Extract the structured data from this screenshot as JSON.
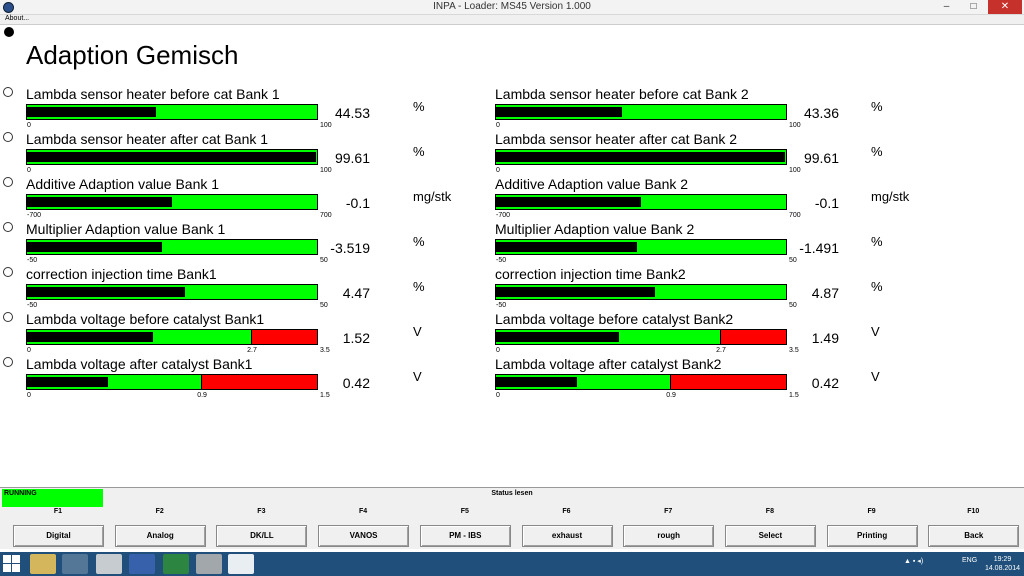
{
  "window": {
    "title": "INPA - Loader:  MS45 Version 1.000",
    "minimize": "–",
    "maximize": "□",
    "close": "✕"
  },
  "menu": {
    "about": "About..."
  },
  "page": {
    "title": "Adaption Gemisch"
  },
  "left": [
    {
      "label": "Lambda sensor heater before cat Bank 1",
      "value": "44.53",
      "unit": "%",
      "min": "0",
      "max": "100",
      "fill": 0.4453
    },
    {
      "label": "Lambda sensor heater after cat Bank 1",
      "value": "99.61",
      "unit": "%",
      "min": "0",
      "max": "100",
      "fill": 0.9961
    },
    {
      "label": "Additive Adaption value Bank 1",
      "value": "-0.1",
      "unit": "mg/stk",
      "min": "-700",
      "max": "700",
      "fill": 0.4999
    },
    {
      "label": "Multiplier Adaption value Bank 1",
      "value": "-3.519",
      "unit": "%",
      "min": "-50",
      "max": "50",
      "fill": 0.4648
    },
    {
      "label": "correction injection time Bank1",
      "value": "4.47",
      "unit": "%",
      "min": "-50",
      "max": "50",
      "fill": 0.5447
    },
    {
      "label": "Lambda voltage before catalyst Bank1",
      "value": "1.52",
      "unit": "V",
      "min": "0",
      "mid": "2.7",
      "max": "3.5",
      "fill": 0.434,
      "redFrom": 0.771
    },
    {
      "label": "Lambda voltage after catalyst Bank1",
      "value": "0.42",
      "unit": "V",
      "min": "0",
      "mid": "0.9",
      "max": "1.5",
      "fill": 0.28,
      "redFrom": 0.6
    }
  ],
  "right": [
    {
      "label": "Lambda sensor heater before cat Bank 2",
      "value": "43.36",
      "unit": "%",
      "min": "0",
      "max": "100",
      "fill": 0.4336
    },
    {
      "label": "Lambda sensor heater after cat Bank 2",
      "value": "99.61",
      "unit": "%",
      "min": "0",
      "max": "100",
      "fill": 0.9961
    },
    {
      "label": "Additive Adaption value Bank 2",
      "value": "-0.1",
      "unit": "mg/stk",
      "min": "-700",
      "max": "700",
      "fill": 0.4999
    },
    {
      "label": "Multiplier Adaption value Bank 2",
      "value": "-1.491",
      "unit": "%",
      "min": "-50",
      "max": "50",
      "fill": 0.4851
    },
    {
      "label": "correction injection time Bank2",
      "value": "4.87",
      "unit": "%",
      "min": "-50",
      "max": "50",
      "fill": 0.5487
    },
    {
      "label": "Lambda voltage before catalyst Bank2",
      "value": "1.49",
      "unit": "V",
      "min": "0",
      "mid": "2.7",
      "max": "3.5",
      "fill": 0.4257,
      "redFrom": 0.771
    },
    {
      "label": "Lambda voltage after catalyst Bank2",
      "value": "0.42",
      "unit": "V",
      "min": "0",
      "mid": "0.9",
      "max": "1.5",
      "fill": 0.28,
      "redFrom": 0.6
    }
  ],
  "status": {
    "running": "RUNNING",
    "lesen": "Status lesen"
  },
  "fkeys": [
    {
      "key": "F1",
      "label": "Digital"
    },
    {
      "key": "F2",
      "label": "Analog"
    },
    {
      "key": "F3",
      "label": "DK/LL"
    },
    {
      "key": "F4",
      "label": "VANOS"
    },
    {
      "key": "F5",
      "label": "PM - IBS"
    },
    {
      "key": "F6",
      "label": "exhaust"
    },
    {
      "key": "F7",
      "label": "rough"
    },
    {
      "key": "F8",
      "label": "Select"
    },
    {
      "key": "F9",
      "label": "Printing"
    },
    {
      "key": "F10",
      "label": "Back"
    }
  ],
  "taskbar": {
    "lang": "ENG",
    "time": "19:29",
    "date": "14.08.2014",
    "icons": [
      "file-explorer-icon",
      "media-player-icon",
      "chrome-icon",
      "save-icon",
      "excel-icon",
      "tool-icon",
      "bmw-icon"
    ]
  },
  "colors": {
    "bar_green": "#00ff00",
    "bar_red": "#ff0000",
    "taskbar": "#1f4f7a"
  }
}
